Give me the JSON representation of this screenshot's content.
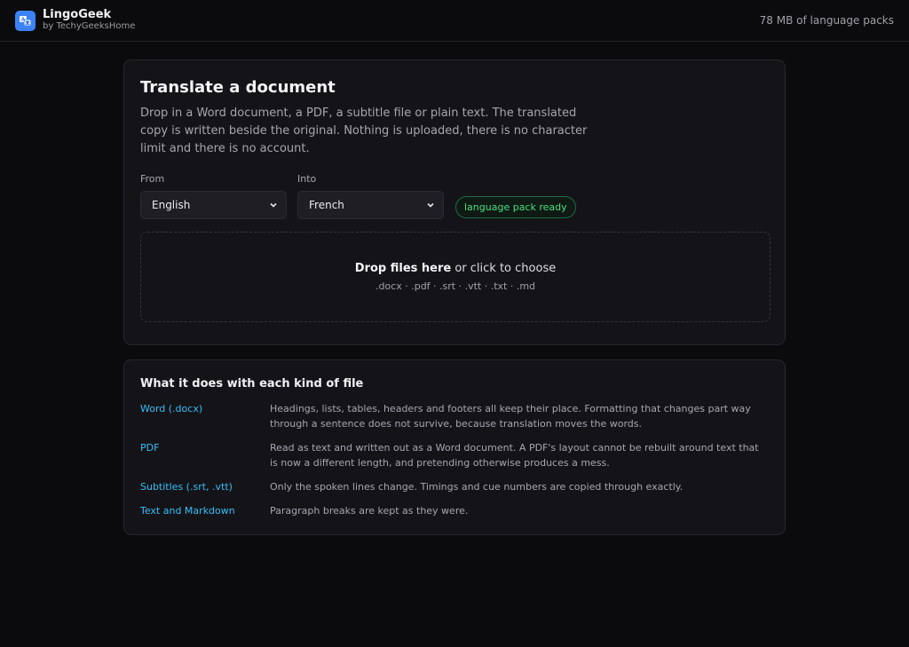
{
  "header": {
    "app_name": "LingoGeek",
    "app_sub": "by TechyGeeksHome",
    "storage": "78 MB of language packs"
  },
  "translate": {
    "title": "Translate a document",
    "description": "Drop in a Word document, a PDF, a subtitle file or plain text. The translated copy is written beside the original. Nothing is uploaded, there is no character limit and there is no account.",
    "from_label": "From",
    "from_value": "English",
    "into_label": "Into",
    "into_value": "French",
    "status_badge": "language pack ready",
    "drop_bold": "Drop files here",
    "drop_rest": " or click to choose",
    "drop_types": ".docx · .pdf · .srt · .vtt · .txt · .md"
  },
  "info": {
    "title": "What it does with each kind of file",
    "rows": [
      {
        "kind": "Word (.docx)",
        "detail": "Headings, lists, tables, headers and footers all keep their place. Formatting that changes part way through a sentence does not survive, because translation moves the words."
      },
      {
        "kind": "PDF",
        "detail": "Read as text and written out as a Word document. A PDF's layout cannot be rebuilt around text that is now a different length, and pretending otherwise produces a mess."
      },
      {
        "kind": "Subtitles (.srt, .vtt)",
        "detail": "Only the spoken lines change. Timings and cue numbers are copied through exactly."
      },
      {
        "kind": "Text and Markdown",
        "detail": "Paragraph breaks are kept as they were."
      }
    ]
  },
  "icons": {
    "logo": "translate-icon",
    "dropdown": "chevron-down-icon"
  },
  "colors": {
    "accent": "#3b82f6",
    "link": "#38bdf8",
    "success": "#4ade80",
    "background": "#0b0b0d",
    "card": "#141418"
  }
}
